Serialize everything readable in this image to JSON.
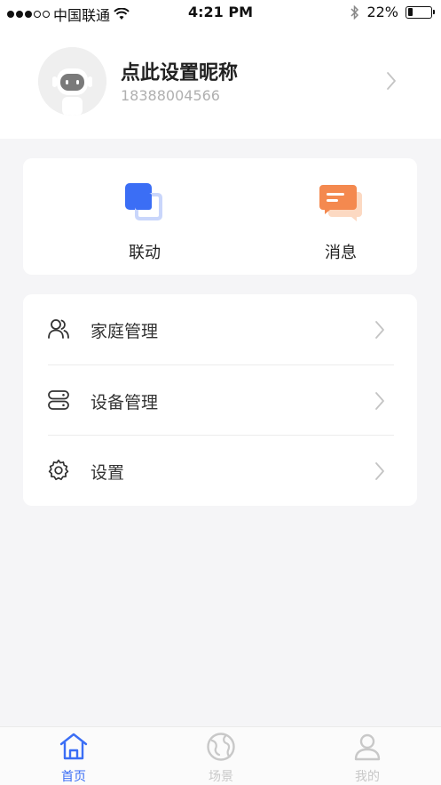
{
  "status_bar": {
    "carrier": "中国联通",
    "time": "4:21 PM",
    "battery_percent": "22%",
    "battery_level": 0.22,
    "signal_filled": 3,
    "signal_total": 5
  },
  "profile": {
    "nickname": "点此设置昵称",
    "phone": "18388004566"
  },
  "quick_actions": [
    {
      "label": "联动",
      "icon": "linkage-icon",
      "color": "#3b6ef5"
    },
    {
      "label": "消息",
      "icon": "message-icon",
      "color": "#f4894f"
    }
  ],
  "menu": [
    {
      "label": "家庭管理",
      "icon": "family-icon"
    },
    {
      "label": "设备管理",
      "icon": "device-icon"
    },
    {
      "label": "设置",
      "icon": "gear-icon"
    }
  ],
  "tabs": [
    {
      "label": "首页",
      "icon": "home-icon",
      "active": true
    },
    {
      "label": "场景",
      "icon": "scene-icon",
      "active": false
    },
    {
      "label": "我的",
      "icon": "user-icon",
      "active": false
    }
  ],
  "colors": {
    "accent": "#3b6ef5",
    "inactive_tab": "#c8c8c8",
    "chevron": "#c4c4c4"
  }
}
